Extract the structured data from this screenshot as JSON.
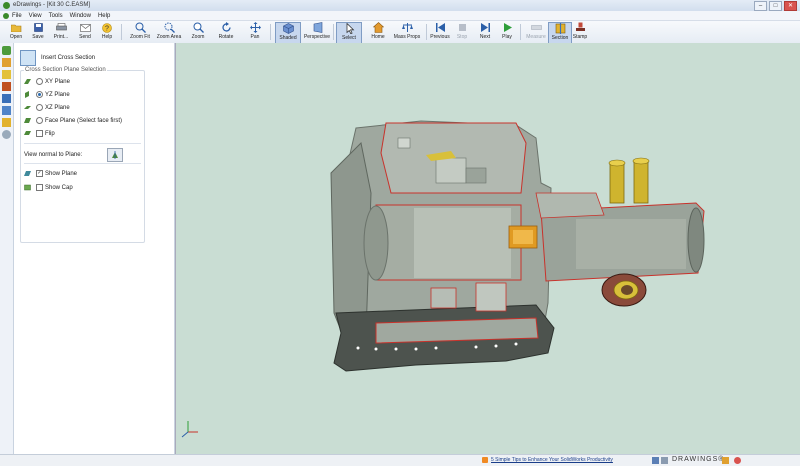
{
  "app": {
    "title": "eDrawings - [Kit 30 C.EASM]",
    "window_buttons": [
      "–",
      "□",
      "✕"
    ]
  },
  "menu": [
    "File",
    "View",
    "Tools",
    "Window",
    "Help"
  ],
  "toolbar": [
    {
      "name": "open-button",
      "label": "Open",
      "icon": "folder-open-icon"
    },
    {
      "name": "save-button",
      "label": "Save",
      "icon": "save-icon"
    },
    {
      "name": "print-button",
      "label": "Print...",
      "icon": "print-icon"
    },
    {
      "name": "send-button",
      "label": "Send",
      "icon": "send-icon"
    },
    {
      "name": "help-button",
      "label": "Help",
      "icon": "help-icon"
    },
    {
      "name": "zoom-fit-button",
      "label": "Zoom Fit",
      "icon": "zoom-fit-icon"
    },
    {
      "name": "zoom-area-button",
      "label": "Zoom Area",
      "icon": "zoom-area-icon"
    },
    {
      "name": "zoom-button",
      "label": "Zoom",
      "icon": "zoom-icon"
    },
    {
      "name": "rotate-button",
      "label": "Rotate",
      "icon": "rotate-icon"
    },
    {
      "name": "pan-button",
      "label": "Pan",
      "icon": "pan-icon"
    },
    {
      "name": "shaded-button",
      "label": "Shaded",
      "icon": "shaded-cube-icon",
      "active": true
    },
    {
      "name": "perspective-button",
      "label": "Perspective",
      "icon": "perspective-icon"
    },
    {
      "name": "select-button",
      "label": "Select",
      "icon": "cursor-icon",
      "active": true
    },
    {
      "name": "home-button",
      "label": "Home",
      "icon": "home-icon"
    },
    {
      "name": "mass-props-button",
      "label": "Mass Props",
      "icon": "mass-props-icon"
    },
    {
      "name": "previous-button",
      "label": "Previous",
      "icon": "previous-icon"
    },
    {
      "name": "stop-button",
      "label": "Stop",
      "icon": "stop-icon",
      "disabled": true
    },
    {
      "name": "next-button",
      "label": "Next",
      "icon": "next-icon"
    },
    {
      "name": "play-button",
      "label": "Play",
      "icon": "play-icon"
    },
    {
      "name": "measure-button",
      "label": "Measure",
      "icon": "measure-icon",
      "disabled": true
    },
    {
      "name": "section-button",
      "label": "Section",
      "icon": "section-icon",
      "active": true
    },
    {
      "name": "stamp-button",
      "label": "Stamp",
      "icon": "stamp-icon"
    }
  ],
  "panel": {
    "header": "Insert Cross Section",
    "group_title": "Cross Section Plane Selection",
    "planes": [
      {
        "label": "XY Plane",
        "selected": false
      },
      {
        "label": "YZ Plane",
        "selected": true
      },
      {
        "label": "XZ Plane",
        "selected": false
      },
      {
        "label": "Face Plane (Select face first)",
        "selected": false
      }
    ],
    "flip_label": "Flip",
    "flip_checked": false,
    "view_normal_label": "View normal to Plane:",
    "show_plane_label": "Show Plane",
    "show_plane_checked": true,
    "show_cap_label": "Show Cap",
    "show_cap_checked": false
  },
  "statusbar": {
    "tip_link": "5 Simple Tips to Enhance Your SolidWorks Productivity",
    "brand": "DRAWINGS®"
  },
  "colors": {
    "viewport_bg": "#c9ddd3",
    "model_gray": "#a7afa5",
    "section_edge": "#c8322b",
    "brass": "#d8c03a",
    "orange": "#e09a22"
  }
}
